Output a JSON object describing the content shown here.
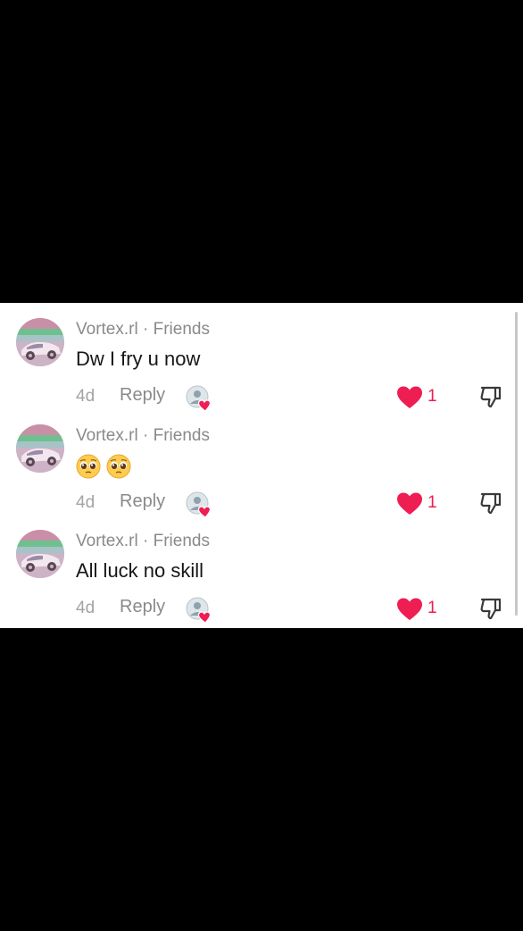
{
  "comments": [
    {
      "username": "Vortex.rl",
      "relation": "Friends",
      "separator": " · ",
      "text": "Dw I fry u now",
      "emojis": [],
      "time": "4d",
      "reply_label": "Reply",
      "likes": "1",
      "liked_by_creator": true
    },
    {
      "username": "Vortex.rl",
      "relation": "Friends",
      "separator": " · ",
      "text": "",
      "emojis": [
        "pleading-face",
        "pleading-face"
      ],
      "time": "4d",
      "reply_label": "Reply",
      "likes": "1",
      "liked_by_creator": true
    },
    {
      "username": "Vortex.rl",
      "relation": "Friends",
      "separator": " · ",
      "text": "All luck no skill",
      "emojis": [],
      "time": "4d",
      "reply_label": "Reply",
      "likes": "1",
      "liked_by_creator": true
    }
  ],
  "colors": {
    "like": "#ee1d52",
    "muted": "#8a8a8a",
    "text": "#161616",
    "background": "#ffffff"
  }
}
